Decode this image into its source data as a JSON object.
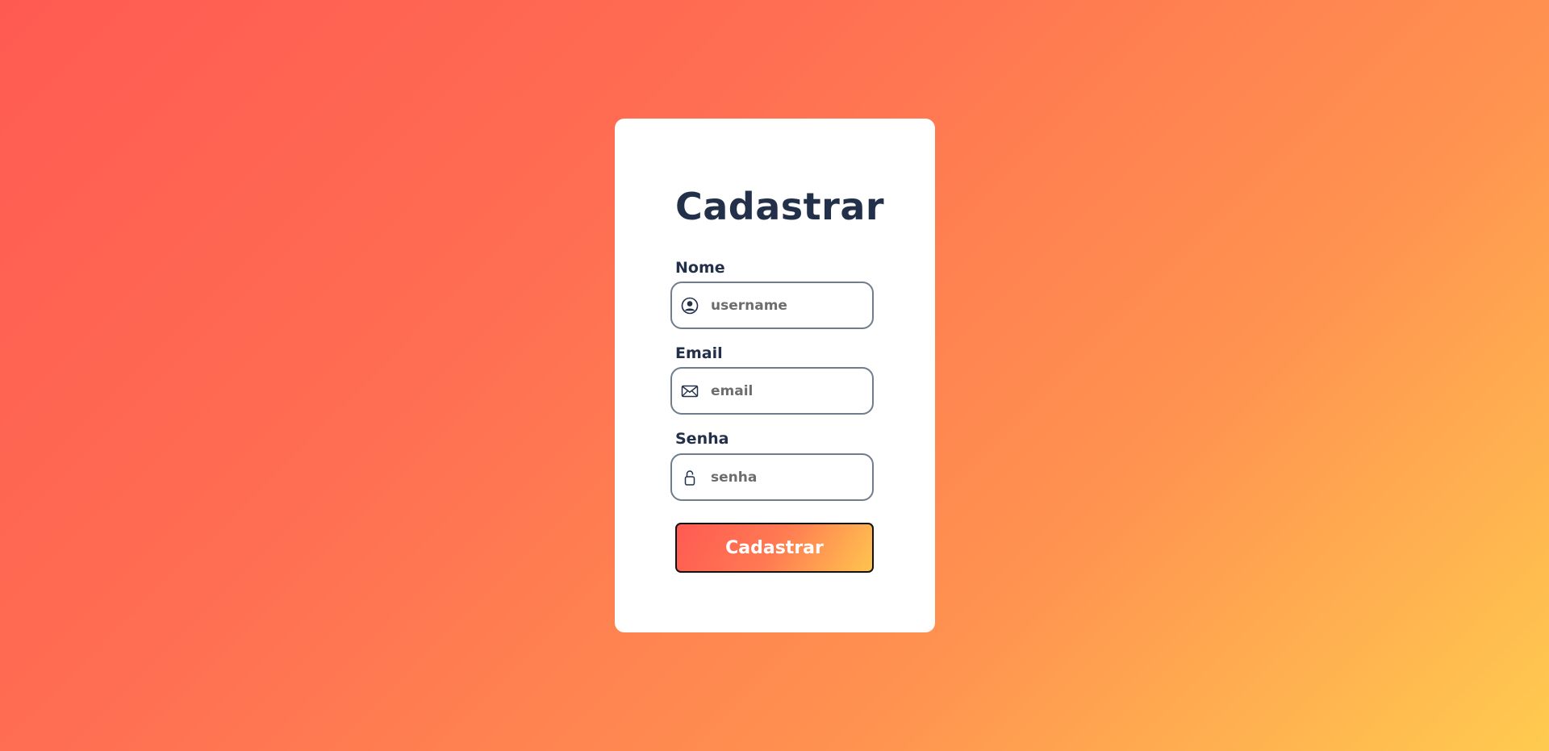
{
  "form": {
    "title": "Cadastrar",
    "fields": [
      {
        "label": "Nome",
        "placeholder": "username",
        "value": "",
        "icon": "user-circle-icon"
      },
      {
        "label": "Email",
        "placeholder": "email",
        "value": "",
        "icon": "envelope-icon"
      },
      {
        "label": "Senha",
        "placeholder": "senha",
        "value": "",
        "icon": "lock-icon"
      }
    ],
    "submit_label": "Cadastrar"
  },
  "colors": {
    "background_start": "#ff5a52",
    "background_end": "#ffcb4f",
    "card": "#ffffff",
    "text": "#22304a",
    "input_border": "#6f7d8c",
    "button_start": "#ff5a52",
    "button_end": "#ffc44f"
  }
}
